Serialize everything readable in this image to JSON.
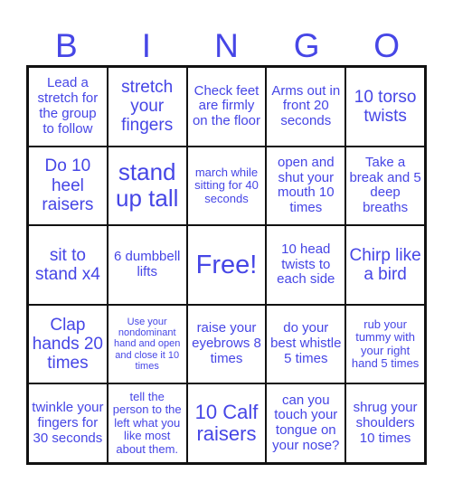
{
  "header": {
    "letters": [
      "B",
      "I",
      "N",
      "G",
      "O"
    ]
  },
  "grid": {
    "rows": [
      [
        "Lead a stretch for the group to follow",
        "stretch your fingers",
        "Check feet are firmly on the floor",
        "Arms out in front 20 seconds",
        "10 torso twists"
      ],
      [
        "Do 10 heel raisers",
        "stand up tall",
        "march while sitting for 40 seconds",
        "open and shut your mouth 10 times",
        "Take a break and 5 deep breaths"
      ],
      [
        "sit to stand x4",
        "6 dumbbell lifts",
        "Free!",
        "10 head twists to each side",
        "Chirp like a bird"
      ],
      [
        "Clap hands 20 times",
        "Use your nondominant hand and open and close it 10 times",
        "raise your eyebrows 8 times",
        "do your best whistle 5 times",
        "rub your tummy with your right hand 5 times"
      ],
      [
        "twinkle your fingers for 30 seconds",
        "tell the person to the left what you like most about them.",
        "10 Calf raisers",
        "can you touch your tongue on your nose?",
        "shrug your shoulders 10 times"
      ]
    ]
  },
  "colors": {
    "text": "#4646e6",
    "border": "#111111"
  }
}
